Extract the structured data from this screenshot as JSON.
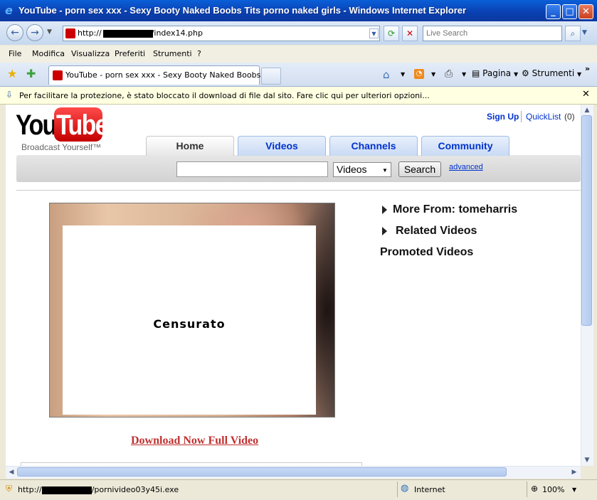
{
  "window": {
    "title": "YouTube - porn sex xxx - Sexy Booty Naked Boobs Tits porno naked girls - Windows Internet Explorer"
  },
  "address": {
    "prefix": "http://",
    "suffix": "/index14.php",
    "search_placeholder": "Live Search"
  },
  "menu": {
    "items": [
      "File",
      "Modifica",
      "Visualizza",
      "Preferiti",
      "Strumenti",
      "?"
    ]
  },
  "tabs": {
    "active_label": "YouTube - porn sex xxx - Sexy Booty Naked Boobs Ti...",
    "page_label": "Pagina",
    "tools_label": "Strumenti"
  },
  "infobar": {
    "text": "Per facilitare la protezione, è stato bloccato il download di file dal sito. Fare clic qui per ulteriori opzioni..."
  },
  "youtube": {
    "logo_you": "You",
    "logo_tube": "Tube",
    "slogan": "Broadcast Yourself™",
    "sign_up": "Sign Up",
    "quicklist": "QuickList",
    "quicklist_count": "(0)",
    "nav_tabs": [
      "Home",
      "Videos",
      "Channels",
      "Community"
    ],
    "search_category": "Videos",
    "search_button": "Search",
    "advanced": "advanced",
    "video_label": "Censurato",
    "download_link": "Download Now Full Video",
    "more_from": "More From: tomeharris",
    "related": "Related Videos",
    "promoted": "Promoted Videos"
  },
  "status": {
    "url_prefix": "http://",
    "url_suffix": "/pornivideo03y45i.exe",
    "zone": "Internet",
    "zoom": "100%"
  },
  "colors": {
    "titlebar": "#0a3fb0",
    "youtube_red": "#cc0000",
    "link_blue": "#0033cc",
    "download_red": "#c03030"
  }
}
